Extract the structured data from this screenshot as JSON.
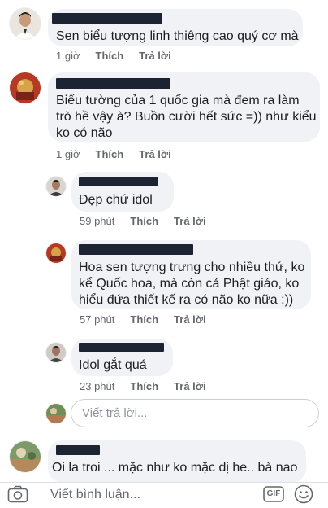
{
  "comments": [
    {
      "text_lines": [
        "Sen biểu tượng linh thiêng cao quý cơ mà"
      ],
      "time": "1 giờ",
      "like": "Thích",
      "reply": "Trả lời"
    },
    {
      "text_lines": [
        "Biểu tường của 1 quốc gia mà đem ra làm",
        "trò hề vậy à? Buồn cười hết sức =)) như kiểu",
        "ko có não"
      ],
      "time": "1 giờ",
      "like": "Thích",
      "reply": "Trả lời"
    },
    {
      "text_lines": [
        "Đẹp chứ idol"
      ],
      "time": "59 phút",
      "like": "Thích",
      "reply": "Trả lời"
    },
    {
      "text_lines": [
        "Hoa sen tượng trưng cho nhiều thứ, ko",
        "kể Quốc hoa, mà còn cả Phật giáo, ko",
        "hiểu đứa thiết kế ra có não ko nữa :))"
      ],
      "time": "57 phút",
      "like": "Thích",
      "reply": "Trả lời"
    },
    {
      "text_lines": [
        "Idol gắt quá"
      ],
      "time": "23 phút",
      "like": "Thích",
      "reply": "Trả lời"
    },
    {
      "text_lines": [
        "Oi la troi ... mặc như ko mặc dị he.. bà nao"
      ]
    }
  ],
  "reply_input": {
    "placeholder": "Viết trả lời..."
  },
  "comment_input": {
    "placeholder": "Viết bình luận..."
  },
  "icons": {
    "camera": "camera-icon",
    "gif": "GIF",
    "emoji": "smiley-icon"
  },
  "colors": {
    "bubble": "#f0f2f5",
    "meta_text": "#65676b",
    "redaction": "#1c2333"
  }
}
